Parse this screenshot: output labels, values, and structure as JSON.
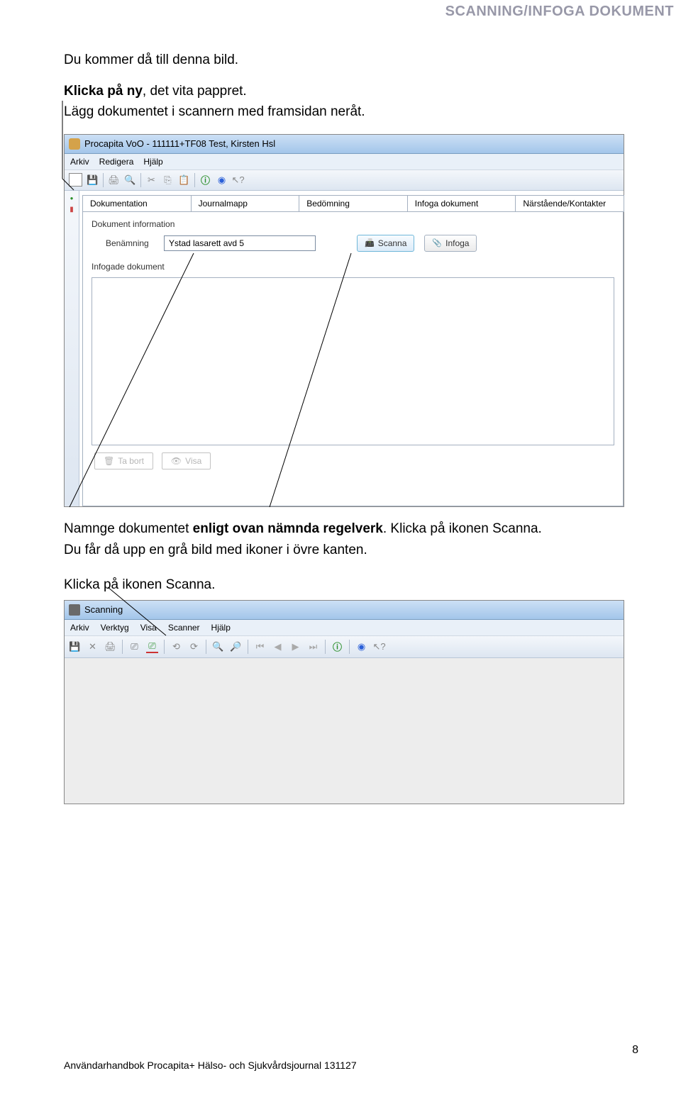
{
  "header": "SCANNING/INFOGA DOKUMENT",
  "intro": {
    "line1": "Du kommer då till denna bild.",
    "line2a": "Klicka på ny",
    "line2b": ", det vita pappret.",
    "line3": "Lägg dokumentet i scannern med framsidan neråt."
  },
  "procapita": {
    "title": "Procapita VoO - 111111+TF08 Test, Kirsten Hsl",
    "menu": [
      "Arkiv",
      "Redigera",
      "Hjälp"
    ],
    "tabs": [
      "Dokumentation",
      "Journalmapp",
      "Bedömning",
      "Infoga dokument",
      "Närstående/Kontakter"
    ],
    "section1": "Dokument information",
    "field_label": "Benämning",
    "field_value": "Ystad lasarett avd 5",
    "btn_scanna": "Scanna",
    "btn_infoga": "Infoga",
    "section2": "Infogade dokument",
    "btn_tabort": "Ta bort",
    "btn_visa": "Visa"
  },
  "mid": {
    "line1a": "Namnge dokumentet ",
    "line1b": "enligt ovan nämnda regelverk",
    "line1c": ". Klicka på ikonen Scanna.",
    "line2": "Du får då upp en grå bild med ikoner i övre kanten.",
    "line3": "Klicka på ikonen Scanna."
  },
  "scanning": {
    "title": "Scanning",
    "menu": [
      "Arkiv",
      "Verktyg",
      "Visa",
      "Scanner",
      "Hjälp"
    ]
  },
  "footer": "Användarhandbok Procapita+ Hälso- och Sjukvårdsjournal 131127",
  "page_number": "8"
}
